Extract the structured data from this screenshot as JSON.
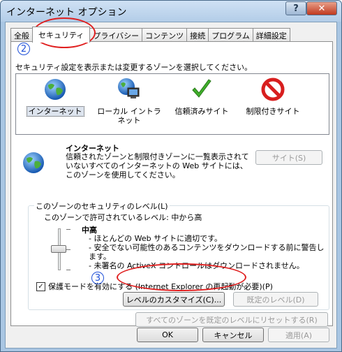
{
  "window": {
    "title": "インターネット オプション",
    "help_label": "?",
    "close_label": "✕"
  },
  "tabs": [
    {
      "label": "全般",
      "active": false
    },
    {
      "label": "セキュリティ",
      "active": true
    },
    {
      "label": "プライバシー",
      "active": false
    },
    {
      "label": "コンテンツ",
      "active": false
    },
    {
      "label": "接続",
      "active": false
    },
    {
      "label": "プログラム",
      "active": false
    },
    {
      "label": "詳細設定",
      "active": false
    }
  ],
  "instruction": "セキュリティ設定を表示または変更するゾーンを選択してください。",
  "zones": [
    {
      "label": "インターネット",
      "icon": "globe-icon",
      "selected": true
    },
    {
      "label": "ローカル イントラネット",
      "icon": "intranet-icon",
      "selected": false
    },
    {
      "label": "信頼済みサイト",
      "icon": "checkmark-icon",
      "selected": false
    },
    {
      "label": "制限付きサイト",
      "icon": "restricted-icon",
      "selected": false
    }
  ],
  "zone_info": {
    "title": "インターネット",
    "description": "信頼されたゾーンと制限付きゾーンに一覧表示されていないすべてのインターネットの Web サイトには、このゾーンを使用してください。",
    "sites_button": "サイト(S)"
  },
  "security_level": {
    "group_label": "このゾーンのセキュリティのレベル(L)",
    "allowed_text": "このゾーンで許可されているレベル: 中から高",
    "level_name": "中高",
    "descriptions": [
      "- ほとんどの Web サイトに適切です。",
      "- 安全でない可能性のあるコンテンツをダウンロードする前に警告します。",
      "- 未署名の ActiveX コントロールはダウンロードされません。"
    ],
    "slider_value": 0.5
  },
  "protected_mode": {
    "label": "保護モードを有効にする (Internet Explorer の再起動が必要)(P)",
    "checked": true
  },
  "buttons": {
    "custom_level": "レベルのカスタマイズ(C)...",
    "default_level": "既定のレベル(D)",
    "reset_all": "すべてのゾーンを既定のレベルにリセットする(R)",
    "ok": "OK",
    "cancel": "キャンセル",
    "apply": "適用(A)"
  },
  "annotations": {
    "step2": "2",
    "step3": "3"
  },
  "colors": {
    "annotation_circle": "#e02020",
    "annotation_number": "#1e4fd8"
  }
}
